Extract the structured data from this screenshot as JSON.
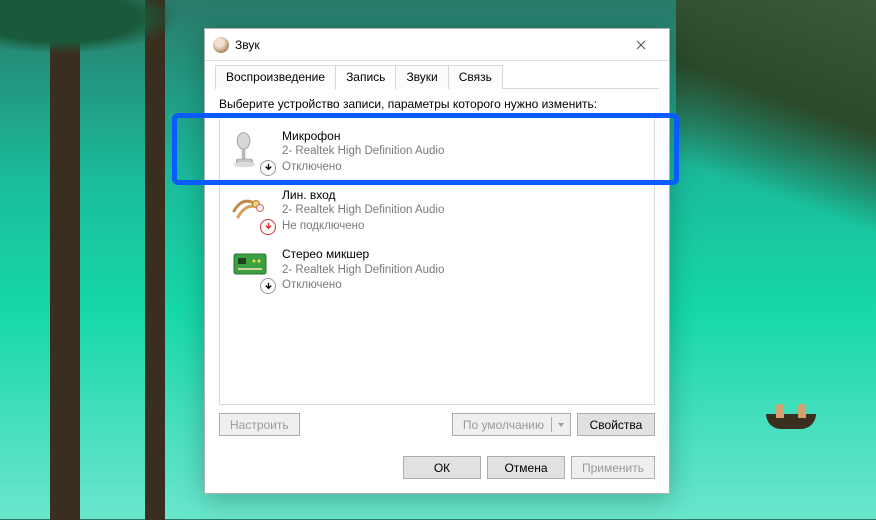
{
  "window": {
    "title": "Звук"
  },
  "tabs": [
    {
      "label": "Воспроизведение",
      "active": false
    },
    {
      "label": "Запись",
      "active": true
    },
    {
      "label": "Звуки",
      "active": false
    },
    {
      "label": "Связь",
      "active": false
    }
  ],
  "instruction": "Выберите устройство записи, параметры которого нужно изменить:",
  "devices": [
    {
      "name": "Микрофон",
      "description": "2- Realtek High Definition Audio",
      "status": "Отключено",
      "icon": "microphone",
      "badge": "down-arrow",
      "highlighted": true
    },
    {
      "name": "Лин. вход",
      "description": "2- Realtek High Definition Audio",
      "status": "Не подключено",
      "icon": "line-in",
      "badge": "down-arrow-red"
    },
    {
      "name": "Стерео микшер",
      "description": "2- Realtek High Definition Audio",
      "status": "Отключено",
      "icon": "mixer",
      "badge": "down-arrow"
    }
  ],
  "buttons": {
    "configure": "Настроить",
    "set_default": "По умолчанию",
    "properties": "Свойства",
    "ok": "ОК",
    "cancel": "Отмена",
    "apply": "Применить"
  }
}
